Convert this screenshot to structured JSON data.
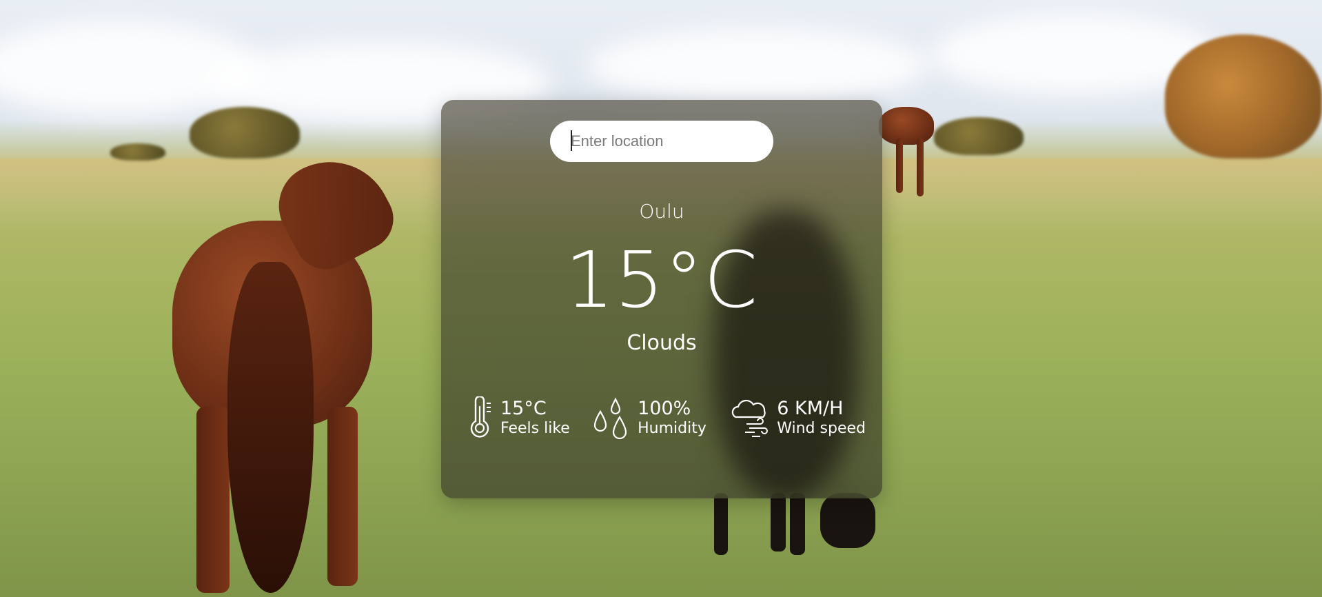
{
  "search": {
    "placeholder": "Enter location",
    "value": ""
  },
  "weather": {
    "city": "Oulu",
    "temperature": "15°C",
    "condition": "Clouds"
  },
  "details": [
    {
      "icon": "thermometer-icon",
      "value": "15°C",
      "label": "Feels like"
    },
    {
      "icon": "humidity-drops-icon",
      "value": "100%",
      "label": "Humidity"
    },
    {
      "icon": "wind-cloud-icon",
      "value": "6 KM/H",
      "label": "Wind speed"
    }
  ],
  "colors": {
    "text": "#ffffff",
    "card_overlay": "#3c3c2d",
    "search_background": "#ffffff"
  }
}
